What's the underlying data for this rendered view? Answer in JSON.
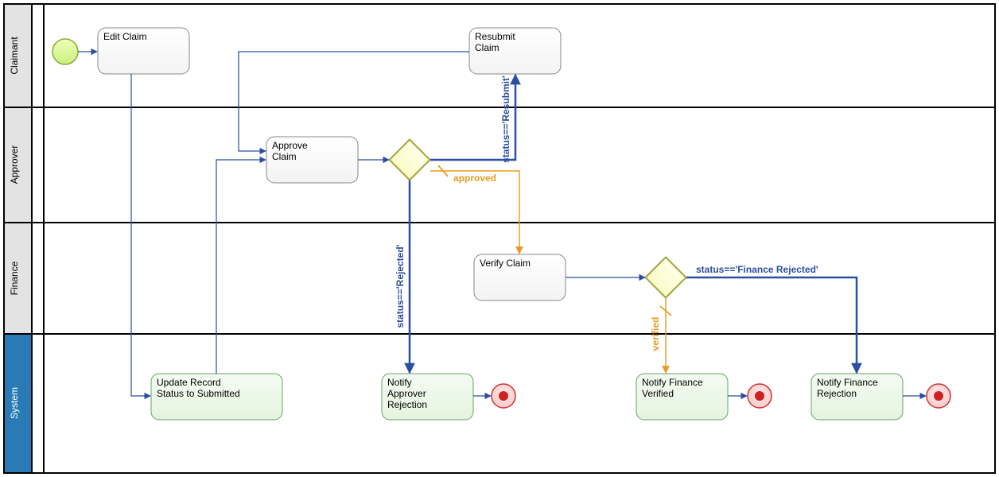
{
  "lanes": {
    "claimant": "Claimant",
    "approver": "Approver",
    "finance": "Finance",
    "system": "System"
  },
  "tasks": {
    "editClaim": "Edit Claim",
    "resubmitClaim1": "Resubmit",
    "resubmitClaim2": "Claim",
    "approveClaim1": "Approve",
    "approveClaim2": "Claim",
    "verifyClaim": "Verify Claim",
    "updateRecord1": "Update Record",
    "updateRecord2": "Status to Submitted",
    "notifyApprover1": "Notify",
    "notifyApprover2": "Approver",
    "notifyApprover3": "Rejection",
    "notifyFinVer1": "Notify Finance",
    "notifyFinVer2": "Verified",
    "notifyFinRej1": "Notify Finance",
    "notifyFinRej2": "Rejection"
  },
  "labels": {
    "statusResubmit": "status=='Resubmit'",
    "statusRejected": "status=='Rejected'",
    "approved": "approved",
    "verified": "verified",
    "statusFinanceRejected": "status=='Finance Rejected'"
  }
}
